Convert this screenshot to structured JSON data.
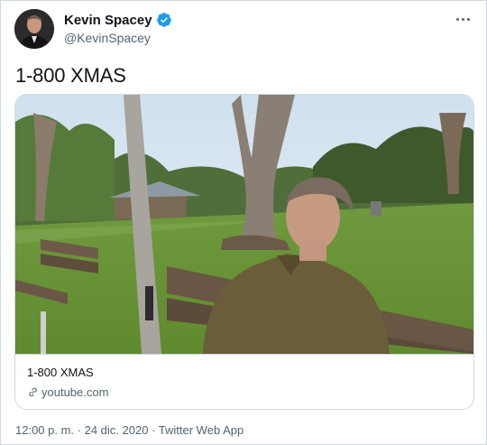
{
  "author": {
    "display_name": "Kevin Spacey",
    "handle": "@KevinSpacey",
    "verified": true,
    "avatar_icon": "avatar-photo"
  },
  "tweet": {
    "text": "1-800 XMAS"
  },
  "card": {
    "title": "1-800 XMAS",
    "domain": "youtube.com",
    "domain_icon": "link-icon",
    "media_icon": "video-thumbnail"
  },
  "meta": {
    "time": "12:00 p. m.",
    "separator1": " · ",
    "date": "24 dic. 2020",
    "separator2": " · ",
    "source": "Twitter Web App"
  },
  "colors": {
    "verified": "#1d9bf0",
    "secondary_text": "#536471",
    "border": "#cfd9de"
  }
}
